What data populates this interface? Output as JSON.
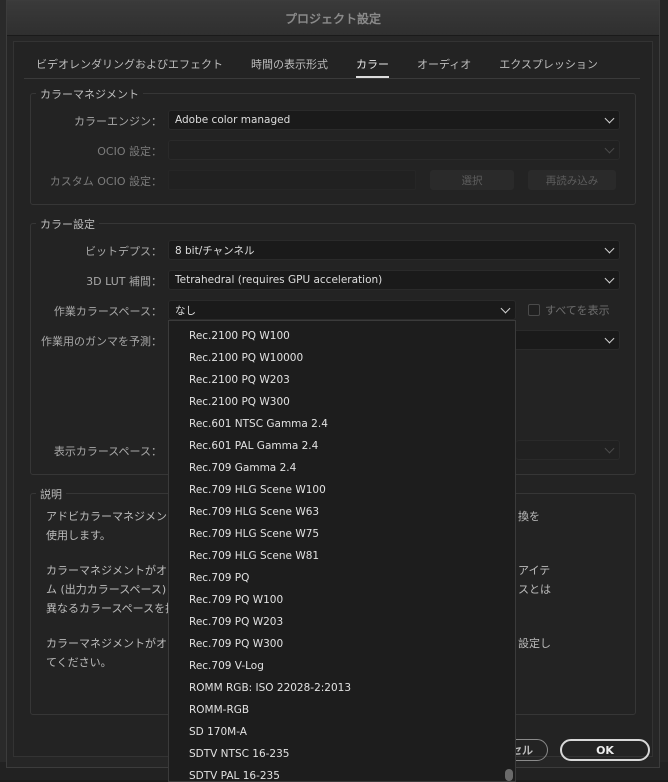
{
  "window": {
    "title": "プロジェクト設定"
  },
  "tabs": [
    {
      "label": "ビデオレンダリングおよびエフェクト",
      "active": false
    },
    {
      "label": "時間の表示形式",
      "active": false
    },
    {
      "label": "カラー",
      "active": true
    },
    {
      "label": "オーディオ",
      "active": false
    },
    {
      "label": "エクスプレッション",
      "active": false
    }
  ],
  "color_management": {
    "title": "カラーマネジメント",
    "engine_label": "カラーエンジン：",
    "engine_value": "Adobe color managed",
    "ocio_label": "OCIO 設定：",
    "custom_ocio_label": "カスタム OCIO 設定：",
    "select_button": "選択",
    "reload_button": "再読み込み"
  },
  "color_settings": {
    "title": "カラー設定",
    "bit_depth_label": "ビットデプス：",
    "bit_depth_value": "8 bit/チャンネル",
    "lut_label": "3D LUT 補間：",
    "lut_value": "Tetrahedral (requires GPU acceleration)",
    "working_space_label": "作業カラースペース：",
    "working_space_value": "なし",
    "show_all_label": "すべてを表示",
    "show_all_checked": false,
    "gamma_label": "作業用のガンマを予測：",
    "display_space_label": "表示カラースペース："
  },
  "description": {
    "title": "説明",
    "para1_left": "アドビカラーマネジメン",
    "para1_left2": "使用します。",
    "para1_right": "換を",
    "para2_left": "カラーマネジメントがオ",
    "para2_left2": "ム (出力カラースペース)",
    "para2_left3": "異なるカラースペースを指",
    "para2_right": "アイテ",
    "para2_right2": "スとは",
    "para3_left": "カラーマネジメントがオ",
    "para3_left2": "てください。",
    "para3_right": "設定し"
  },
  "dropdown_options": [
    "Rec.2100 PQ W100",
    "Rec.2100 PQ W10000",
    "Rec.2100 PQ W203",
    "Rec.2100 PQ W300",
    "Rec.601 NTSC Gamma 2.4",
    "Rec.601 PAL Gamma 2.4",
    "Rec.709 Gamma 2.4",
    "Rec.709 HLG Scene W100",
    "Rec.709 HLG Scene W63",
    "Rec.709 HLG Scene W75",
    "Rec.709 HLG Scene W81",
    "Rec.709 PQ",
    "Rec.709 PQ W100",
    "Rec.709 PQ W203",
    "Rec.709 PQ W300",
    "Rec.709 V-Log",
    "ROMM RGB: ISO 22028-2:2013",
    "ROMM-RGB",
    "SD 170M-A",
    "SDTV NTSC 16-235",
    "SDTV PAL 16-235"
  ],
  "buttons": {
    "cancel": "セル",
    "ok": "OK"
  }
}
